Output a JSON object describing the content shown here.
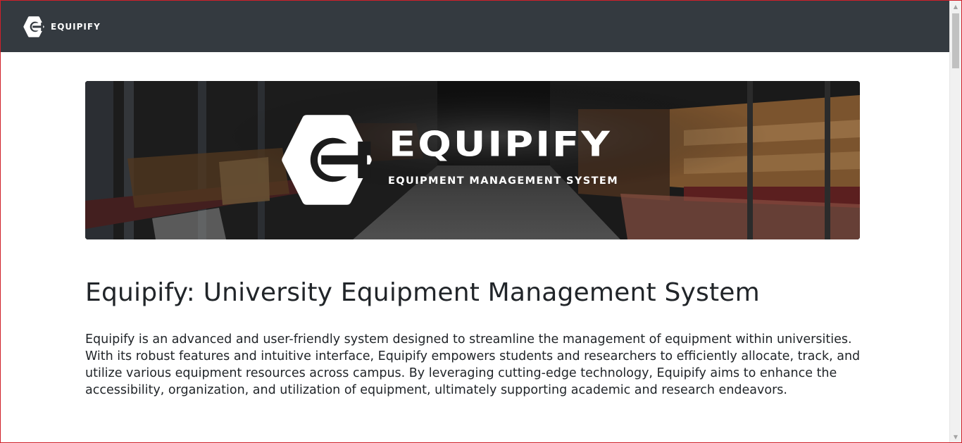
{
  "navbar": {
    "brand_icon": "equipify-logo-icon",
    "brand_name": "EQUIPIFY",
    "background_color": "#343a40"
  },
  "hero": {
    "logo_icon": "equipify-logo-icon",
    "title": "EQUIPIFY",
    "subtitle": "EQUIPMENT MANAGEMENT SYSTEM"
  },
  "main": {
    "heading": "Equipify: University Equipment Management System",
    "description": "Equipify is an advanced and user-friendly system designed to streamline the management of equipment within universities. With its robust features and intuitive interface, Equipify empowers students and researchers to efficiently allocate, track, and utilize various equipment resources across campus. By leveraging cutting-edge technology, Equipify aims to enhance the accessibility, organization, and utilization of equipment, ultimately supporting academic and research endeavors."
  },
  "colors": {
    "text": "#212529",
    "border": "#d0202a"
  }
}
